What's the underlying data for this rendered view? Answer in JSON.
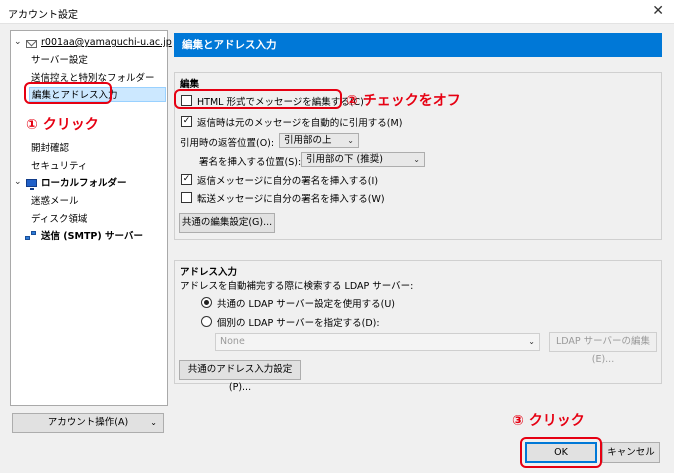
{
  "window": {
    "title": "アカウント設定",
    "close_glyph": "✕"
  },
  "tree": {
    "account_email": "r001aa@yamaguchi-u.ac.jp",
    "items": [
      {
        "label": "サーバー設定"
      },
      {
        "label": "送信控えと特別なフォルダー"
      },
      {
        "label": "編集とアドレス入力"
      },
      {
        "label": "開封確認"
      },
      {
        "label": "セキュリティ"
      }
    ],
    "local_folders": "ローカルフォルダー",
    "local_items": [
      {
        "label": "迷惑メール"
      },
      {
        "label": "ディスク領域"
      }
    ],
    "smtp": "送信 (SMTP) サーバー",
    "account_actions": "アカウント操作(A)"
  },
  "panel": {
    "header": "編集とアドレス入力",
    "compose": {
      "title": "編集",
      "html_compose": "HTML 形式でメッセージを編集する(C)",
      "auto_quote": "返信時は元のメッセージを自動的に引用する(M)",
      "reply_position_label": "引用時の返答位置(O):",
      "reply_position_value": "引用部の上",
      "signature_label": "署名を挿入する位置(S):",
      "signature_value": "引用部の下 (推奨)",
      "sig_reply": "返信メッセージに自分の署名を挿入する(I)",
      "sig_forward": "転送メッセージに自分の署名を挿入する(W)",
      "global_button": "共通の編集設定(G)..."
    },
    "addressing": {
      "title": "アドレス入力",
      "description": "アドレスを自動補完する際に検索する LDAP サーバー:",
      "use_global": "共通の LDAP サーバー設定を使用する(U)",
      "use_specific": "個別の LDAP サーバーを指定する(D):",
      "server_value": "None",
      "edit_button": "LDAP サーバーの編集(E)...",
      "global_button": "共通のアドレス入力設定(P)..."
    }
  },
  "footer": {
    "ok": "OK",
    "cancel": "キャンセル"
  },
  "annotations": {
    "step1": "① クリック",
    "step2": "② チェックをオフ",
    "step3": "③ クリック",
    "color": "#e60012"
  },
  "colors": {
    "accent": "#0078d7",
    "selection": "#cce8ff"
  }
}
